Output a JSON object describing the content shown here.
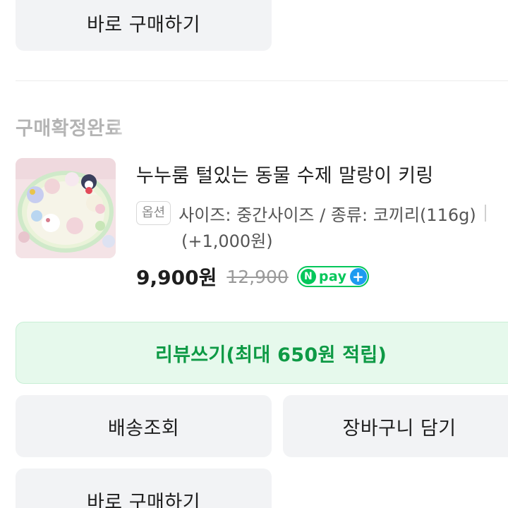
{
  "top_button": {
    "label": "바로 구매하기"
  },
  "order": {
    "status": "구매확정완료",
    "product": {
      "title": "누누룸 털있는 동물 수제 말랑이 키링",
      "option_badge": "옵션",
      "option_text": "사이즈: 중간사이즈 / 종류: 코끼리(116g)",
      "option_extra": "(+1,000원)",
      "price": "9,900원",
      "original_price": "12,900",
      "pay_badge": {
        "n": "N",
        "text": "pay",
        "plus": "+"
      }
    }
  },
  "actions": {
    "review": "리뷰쓰기(최대 650원 적립)",
    "delivery": "배송조회",
    "cart": "장바구니 담기",
    "buy_now": "바로 구매하기"
  },
  "colors": {
    "review_bg": "#e6f9ec",
    "review_text": "#0e9a45",
    "npay_green": "#03c75a",
    "npay_blue": "#1e9bf0",
    "button_bg": "#f2f3f5"
  },
  "icons": {
    "product_thumbnail": "squishy-keyring-photo"
  }
}
